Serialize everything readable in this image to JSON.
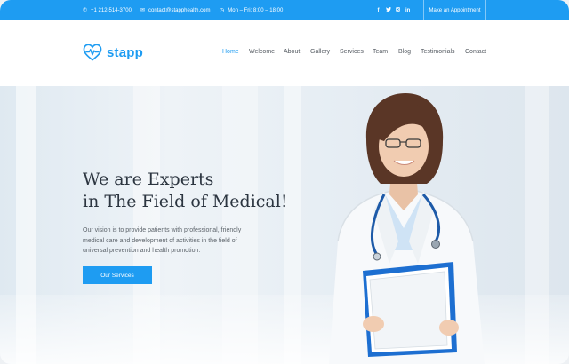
{
  "topbar": {
    "phone": "+1 212-514-3700",
    "email": "contact@stapphealth.com",
    "hours": "Mon – Fri: 8:00 – 18:00",
    "socials": [
      "f",
      "t",
      "ig",
      "in"
    ],
    "appointment_label": "Make an Appointment"
  },
  "brand": {
    "name": "stapp",
    "color": "#1e9cf2"
  },
  "nav": {
    "items": [
      "Home",
      "Welcome",
      "About",
      "Gallery",
      "Services",
      "Team",
      "Blog",
      "Testimonials",
      "Contact"
    ],
    "active": "Home"
  },
  "hero": {
    "headline_line1": "We are Experts",
    "headline_line2": "in The Field of Medical!",
    "description": "Our vision is to provide patients with professional, friendly medical care and development of activities in the field of universal prevention and health promotion.",
    "cta_label": "Our Services"
  },
  "colors": {
    "accent": "#1e9cf2",
    "text_dark": "#2c3540",
    "text_muted": "#5d646b"
  },
  "icons": {
    "phone": "phone-icon",
    "email": "envelope-icon",
    "hours": "clock-icon",
    "socials": [
      "facebook-icon",
      "twitter-icon",
      "instagram-icon",
      "linkedin-icon"
    ],
    "logo": "heart-pulse-icon"
  }
}
